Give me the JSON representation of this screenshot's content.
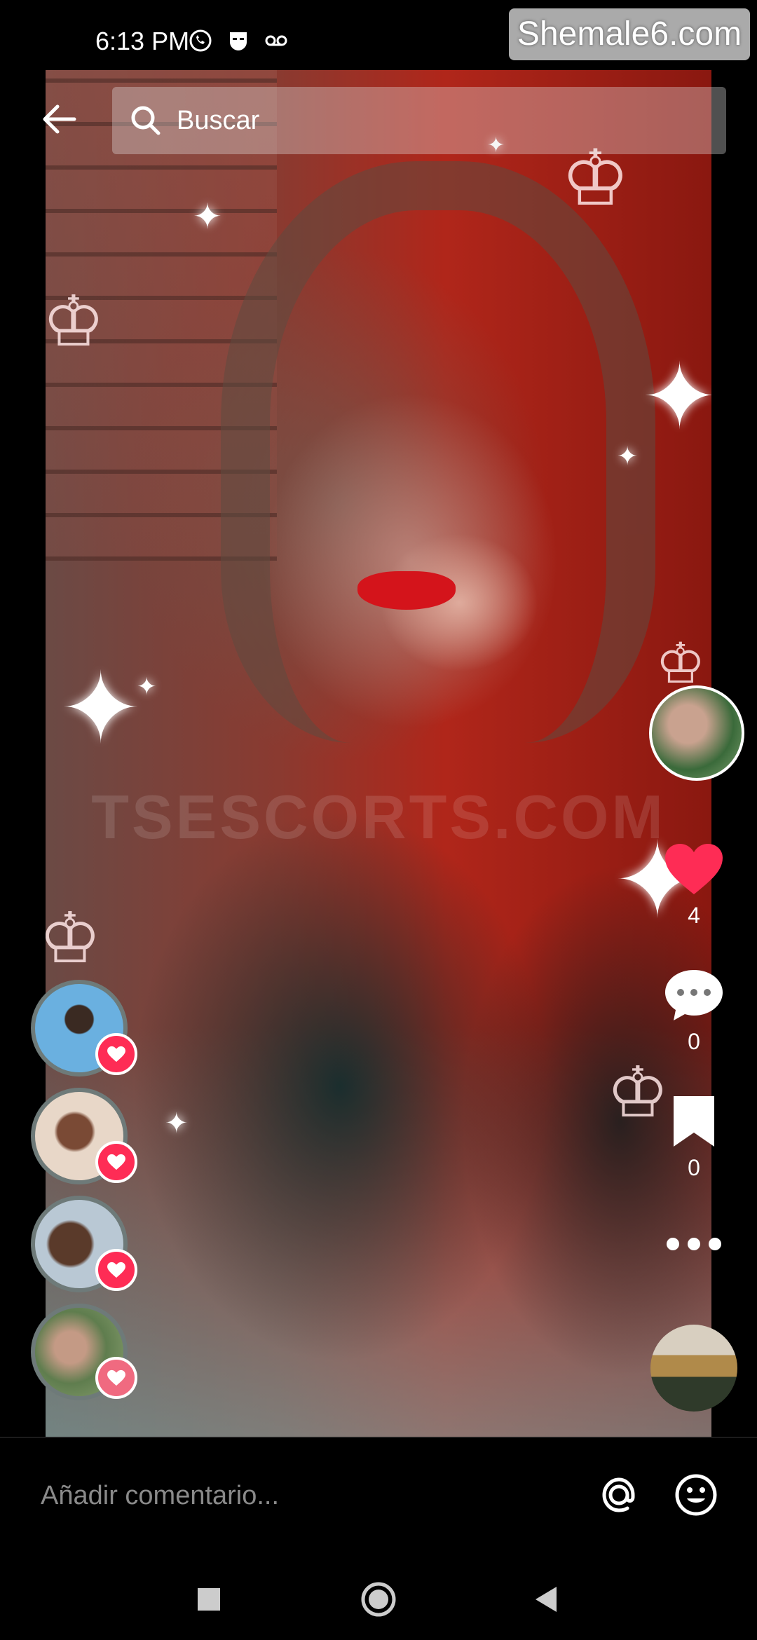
{
  "status_bar": {
    "time": "6:13 PM",
    "icons": [
      "whatsapp-icon",
      "grindr-icon",
      "voicemail-icon"
    ],
    "watermark": "Shemale6.com"
  },
  "header": {
    "back_icon": "arrow-left-icon",
    "search_placeholder": "Buscar"
  },
  "media": {
    "watermark_text": "TSESCORTS.COM"
  },
  "actions": {
    "likes": "4",
    "comments": "0",
    "saves": "0",
    "like_color": "#fe2c55"
  },
  "comment_bar": {
    "placeholder": "Añadir comentario...",
    "mention_icon": "at-icon",
    "emoji_icon": "emoji-icon"
  },
  "nav": [
    "recents-icon",
    "home-icon",
    "back-icon"
  ]
}
